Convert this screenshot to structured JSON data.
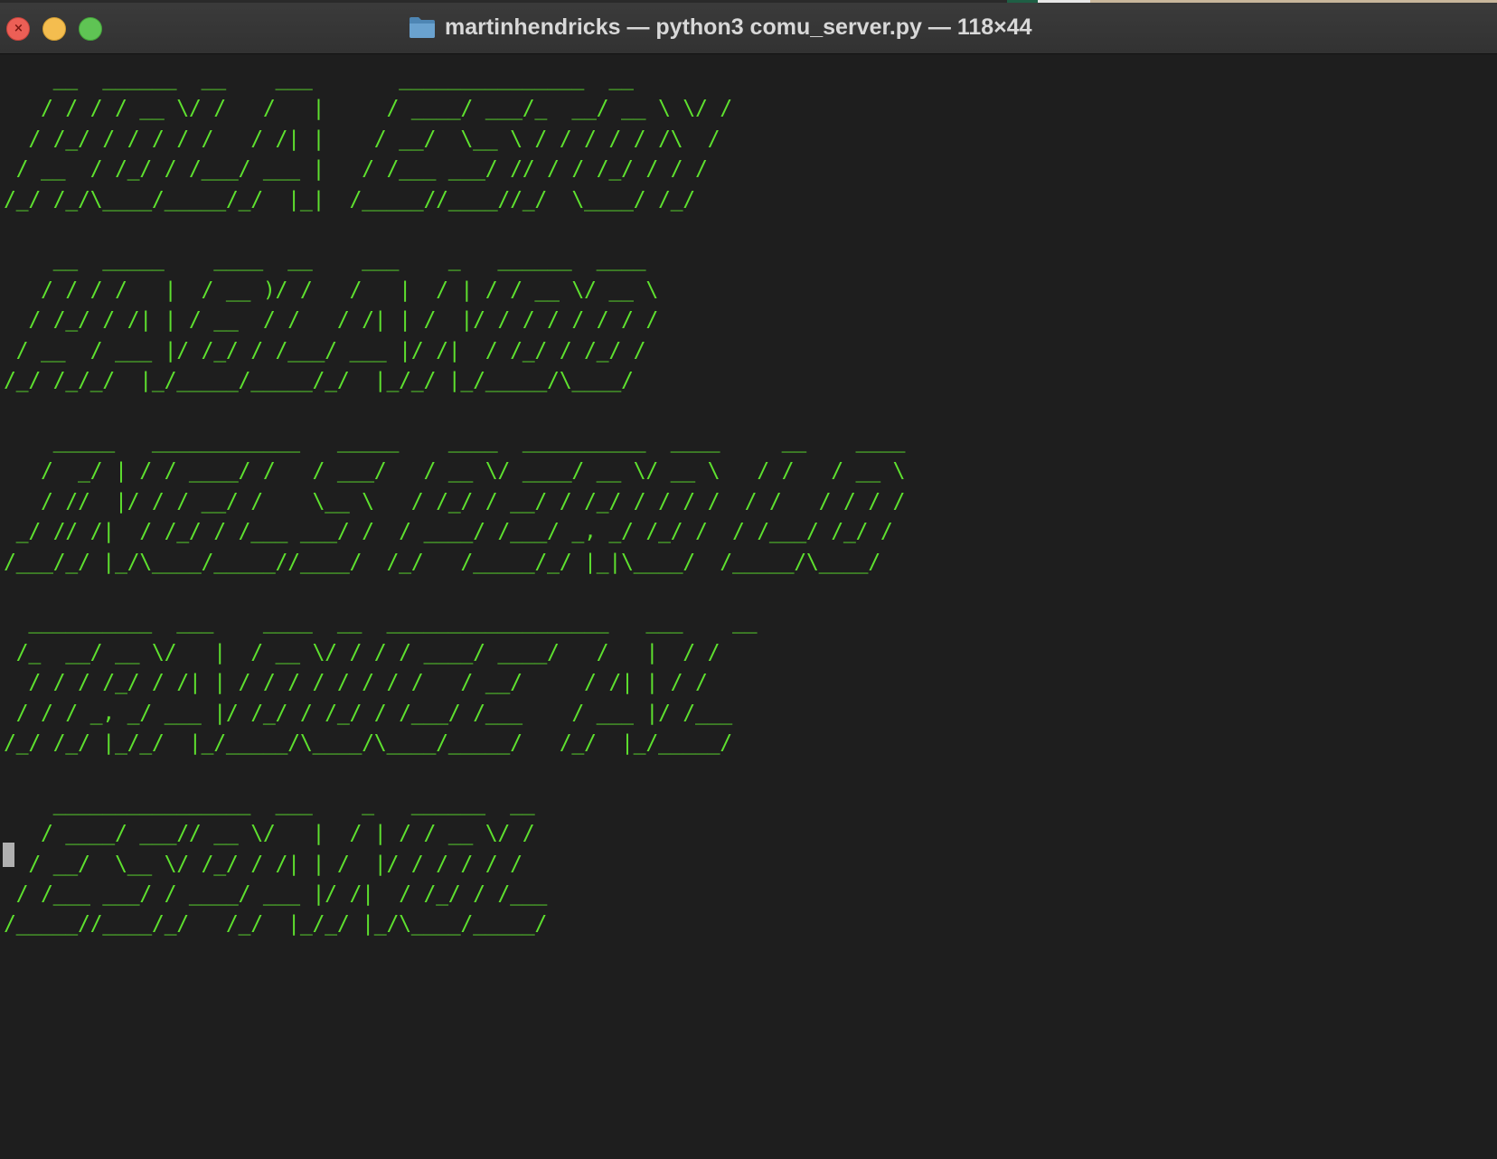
{
  "window": {
    "title": "martinhendricks — python3 comu_server.py — 118×44",
    "icons": {
      "close": "close-icon",
      "minimize": "minimize-icon",
      "maximize": "maximize-icon",
      "folder": "folder-icon"
    }
  },
  "colors": {
    "background": "#1e1e1e",
    "text": "#5ee02f",
    "titlebar": "#363636",
    "cursor": "#b0b0b0"
  },
  "terminal": {
    "output_lines": [
      "    __  ______  __    ___       _______________  __",
      "   / / / / __ \\/ /   /   |     / ____/ ___/_  __/ __ \\ \\/ /",
      "  / /_/ / / / / /   / /| |    / __/  \\__ \\ / / / / / /\\  /",
      " / __  / /_/ / /___/ ___ |   / /___ ___/ // / / /_/ / / /",
      "/_/ /_/\\____/_____/_/  |_|  /_____//____//_/  \\____/ /_/",
      "",
      "    __  _____    ____  __    ___    _   ______  ____",
      "   / / / /   |  / __ )/ /   /   |  / | / / __ \\/ __ \\",
      "  / /_/ / /| | / __  / /   / /| | /  |/ / / / / / / /",
      " / __  / ___ |/ /_/ / /___/ ___ |/ /|  / /_/ / /_/ /",
      "/_/ /_/_/  |_/_____/_____/_/  |_/_/ |_/_____/\\____/",
      "",
      "    _____   ____________   _____    ____  __________  ____     __    ____",
      "   /  _/ | / / ____/ /   / ___/   / __ \\/ ____/ __ \\/ __ \\   / /   / __ \\",
      "   / //  |/ / / __/ /    \\__ \\   / /_/ / __/ / /_/ / / / /  / /   / / / /",
      " _/ // /|  / /_/ / /___ ___/ /  / ____/ /___/ _, _/ /_/ /  / /___/ /_/ /",
      "/___/_/ |_/\\____/_____//____/  /_/   /_____/_/ |_|\\____/  /_____/\\____/",
      "",
      "  __________  ___    ____  __  __________________   ___    __",
      " /_  __/ __ \\/   |  / __ \\/ / / / ____/ ____/   /   |  / /",
      "  / / / /_/ / /| | / / / / / / / /   / __/     / /| | / /",
      " / / / _, _/ ___ |/ /_/ / /_/ / /___/ /___    / ___ |/ /___",
      "/_/ /_/ |_/_/  |_/_____/\\____/\\____/_____/   /_/  |_/_____/",
      "",
      "    ________________  ___    _   ______  __",
      "   / ____/ ___// __ \\/   |  / | / / __ \\/ /",
      "  / __/  \\__ \\/ /_/ / /| | /  |/ / / / / /",
      " / /___ ___/ / ____/ ___ |/ /|  / /_/ / /___",
      "/_____//____/_/   /_/  |_/_/ |_/\\____/_____/"
    ]
  }
}
